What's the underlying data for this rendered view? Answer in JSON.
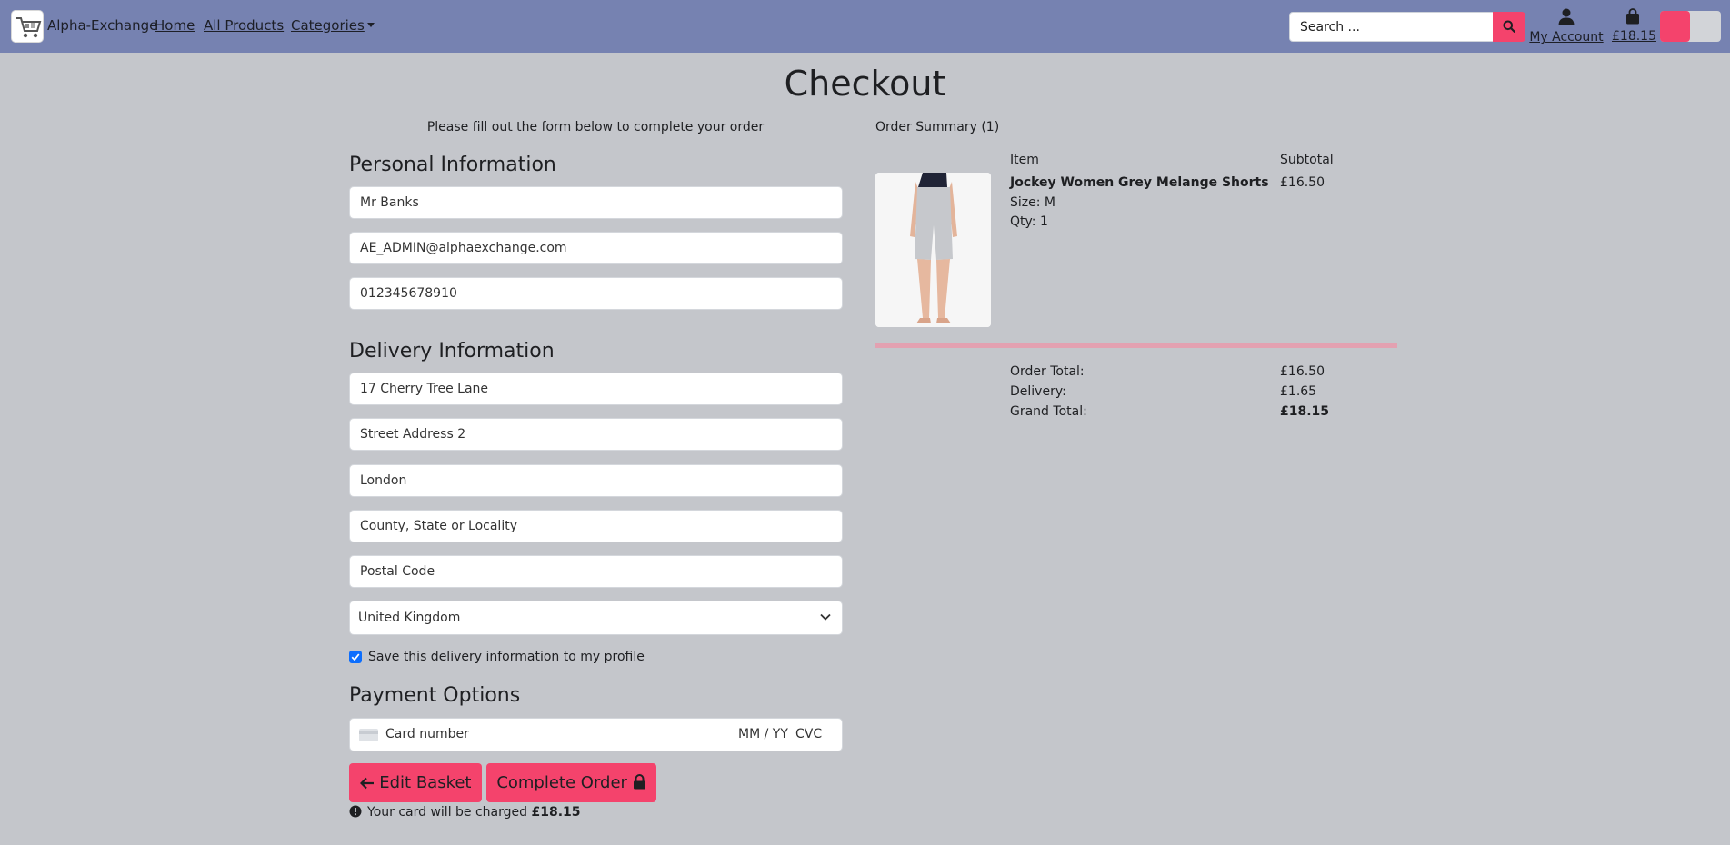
{
  "navbar": {
    "brand": "Alpha-Exchange",
    "links": {
      "home": "Home",
      "all_products": "All Products",
      "categories": "Categories"
    },
    "search": {
      "placeholder": "Search ..."
    },
    "account_label": "My Account",
    "basket_total": "£18.15",
    "accent_color": "#f4436c",
    "bar_color": "#7682b1"
  },
  "page": {
    "title": "Checkout",
    "subtitle": "Please fill out the form below to complete your order"
  },
  "personal": {
    "heading": "Personal Information",
    "full_name": "Mr Banks",
    "email": "AE_ADMIN@alphaexchange.com",
    "phone": "012345678910"
  },
  "delivery": {
    "heading": "Delivery Information",
    "street1": "17 Cherry Tree Lane",
    "street2_placeholder": "Street Address 2",
    "town": "London",
    "county_placeholder": "County, State or Locality",
    "postcode_placeholder": "Postal Code",
    "country": "United Kingdom",
    "save_label": "Save this delivery information to my profile",
    "save_checked": true
  },
  "payment": {
    "heading": "Payment Options",
    "card_number_placeholder": "Card number",
    "expiry_placeholder": "MM / YY",
    "cvc_placeholder": "CVC",
    "edit_basket_label": "Edit Basket",
    "complete_order_label": "Complete Order",
    "charge_note": "Your card will be charged",
    "charge_amount": "£18.15"
  },
  "summary": {
    "title": "Order Summary (1)",
    "col_item": "Item",
    "col_subtotal": "Subtotal",
    "items": [
      {
        "name": "Jockey Women Grey Melange Shorts",
        "size": "Size: M",
        "qty": "Qty: 1",
        "subtotal": "£16.50"
      }
    ],
    "order_total_label": "Order Total:",
    "order_total": "£16.50",
    "delivery_label": "Delivery:",
    "delivery": "£1.65",
    "grand_total_label": "Grand Total:",
    "grand_total": "£18.15"
  }
}
